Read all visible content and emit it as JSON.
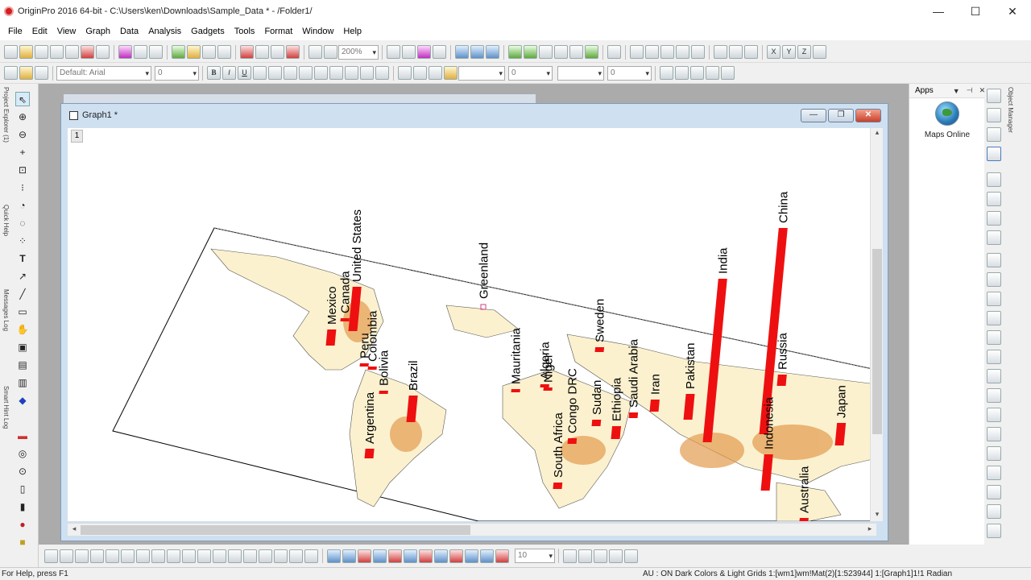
{
  "window": {
    "title": "OriginPro 2016 64-bit - C:\\Users\\ken\\Downloads\\Sample_Data * - /Folder1/",
    "minimize_glyph": "—",
    "maximize_glyph": "☐",
    "close_glyph": "✕"
  },
  "menu": [
    "File",
    "Edit",
    "View",
    "Graph",
    "Data",
    "Analysis",
    "Gadgets",
    "Tools",
    "Format",
    "Window",
    "Help"
  ],
  "toolbar": {
    "zoom_value": "200%",
    "axis_x": "X",
    "axis_y": "Y",
    "axis_z": "Z"
  },
  "format_toolbar": {
    "font_value": "Default: Arial",
    "font_size_value": "0",
    "bold": "B",
    "italic": "I",
    "underline": "U",
    "line_width_value": "0",
    "border_width_value": "0"
  },
  "left_side_tabs": [
    "Project Explorer (1)",
    "Quick Help",
    "Messages Log",
    "Smart Hint Log"
  ],
  "graph_window": {
    "title": "Graph1 *",
    "layer_label": "1"
  },
  "map": {
    "countries": [
      {
        "name": "United States",
        "value": 55
      },
      {
        "name": "Canada",
        "value": 3
      },
      {
        "name": "Mexico",
        "value": 20
      },
      {
        "name": "Colombia",
        "value": 4
      },
      {
        "name": "Peru",
        "value": 3
      },
      {
        "name": "Bolivia",
        "value": 3
      },
      {
        "name": "Brazil",
        "value": 33
      },
      {
        "name": "Argentina",
        "value": 12
      },
      {
        "name": "Greenland",
        "value": 0
      },
      {
        "name": "Mauritania",
        "value": 3
      },
      {
        "name": "Algeria",
        "value": 4
      },
      {
        "name": "Niger",
        "value": 3
      },
      {
        "name": "Congo DRC",
        "value": 7
      },
      {
        "name": "South Africa",
        "value": 8
      },
      {
        "name": "Sudan",
        "value": 8
      },
      {
        "name": "Ethiopia",
        "value": 16
      },
      {
        "name": "Sweden",
        "value": 6
      },
      {
        "name": "Saudi Arabia",
        "value": 7
      },
      {
        "name": "Iran",
        "value": 15
      },
      {
        "name": "Pakistan",
        "value": 32
      },
      {
        "name": "India",
        "value": 203
      },
      {
        "name": "China",
        "value": 256
      },
      {
        "name": "Russia",
        "value": 14
      },
      {
        "name": "Indonesia",
        "value": 45
      },
      {
        "name": "Japan",
        "value": 28
      },
      {
        "name": "Australia",
        "value": 3
      }
    ],
    "bar_color": "#ee1010",
    "land_color": "#fbf1cf",
    "dense_color": "#e39b4e"
  },
  "apps_panel": {
    "header": "Apps",
    "app_label": "Maps Online"
  },
  "right_side_tab": "Object Manager",
  "bottom_toolbar": {
    "size_value": "10"
  },
  "status": {
    "help": "For Help, press F1",
    "info": "AU : ON  Dark Colors & Light Grids  1:[wm1]wm!Mat(2)[1:523944]  1:[Graph1]1!1  Radian"
  }
}
